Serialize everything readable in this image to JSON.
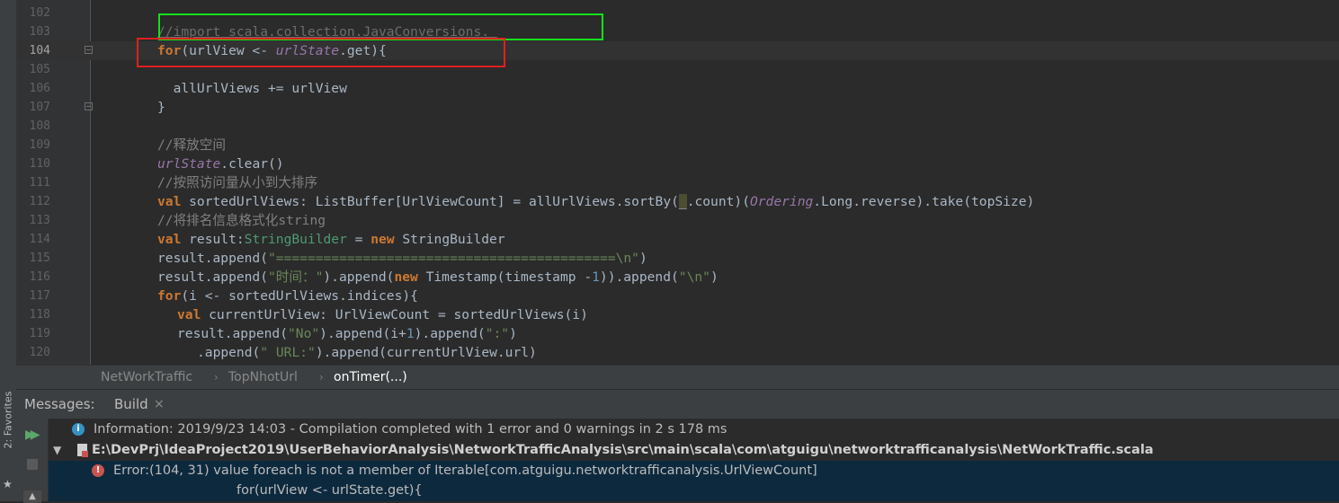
{
  "editor": {
    "lines": [
      {
        "num": "102",
        "text": ""
      },
      {
        "num": "103",
        "text": "//import scala.collection.JavaConversions._"
      },
      {
        "num": "104",
        "kw": "for",
        "a": "(urlView <- ",
        "it": "urlState",
        "b": ".get){"
      },
      {
        "num": "105",
        "text": ""
      },
      {
        "num": "106",
        "text": "  allUrlViews += urlView"
      },
      {
        "num": "107",
        "text": "}"
      },
      {
        "num": "108",
        "text": ""
      },
      {
        "num": "109",
        "text": "//释放空间"
      },
      {
        "num": "110",
        "it": "urlState",
        "b": ".clear()"
      },
      {
        "num": "111",
        "text": "//按照访问量从小到大排序"
      },
      {
        "num": "112",
        "kw": "val",
        "a": " sortedUrlViews: ListBuffer[UrlViewCount] = allUrlViews.sortBy(",
        "hl": "_",
        "b": ".count)(",
        "it": "Ordering",
        "c": ".Long.reverse).take(topSize)"
      },
      {
        "num": "113",
        "text": "//将排名信息格式化string"
      },
      {
        "num": "114",
        "kw": "val",
        "a": " result:",
        "ty": "StringBuilder",
        "b": " = ",
        "kw2": "new",
        "c": " StringBuilder"
      },
      {
        "num": "115",
        "a": "result.append(",
        "str": "\"===========================================\\n\"",
        "b": ")"
      },
      {
        "num": "116",
        "a": "result.append(",
        "str": "\"时间：\"",
        "b": ").append(",
        "kw": "new",
        "c": " Timestamp(timestamp -",
        "num_lit": "1",
        "d": ")).append(",
        "str2": "\"\\n\"",
        "e": ")"
      },
      {
        "num": "117",
        "kw": "for",
        "a": "(i <- sortedUrlViews.indices){"
      },
      {
        "num": "118",
        "kw": "val",
        "a": " currentUrlView: UrlViewCount = sortedUrlViews(i)"
      },
      {
        "num": "119",
        "a": "result.append(",
        "str": "\"No\"",
        "b": ").append(i+",
        "num_lit": "1",
        "c": ").append(",
        "str2": "\":\"",
        "d": ")"
      },
      {
        "num": "120",
        "a": ".append(",
        "str": "\" URL:\"",
        "b": ").append(currentUrlView.url)"
      }
    ]
  },
  "breadcrumb": [
    "NetWorkTraffic",
    "TopNhotUrl",
    "onTimer(...)"
  ],
  "messages_panel": {
    "title": "Messages:",
    "tab": "Build",
    "tab_close": "×",
    "rows": [
      {
        "icon": "info-icon",
        "text": "Information: 2019/9/23 14:03 - Compilation completed with 1 error and 0 warnings in 2 s 178 ms"
      },
      {
        "icon": "file-icon",
        "text": "E:\\DevPrj\\IdeaProject2019\\UserBehaviorAnalysis\\NetworkTrafficAnalysis\\src\\main\\scala\\com\\atguigu\\networktrafficanalysis\\NetWorkTraffic.scala"
      },
      {
        "icon": "error-icon",
        "text": "Error:(104, 31)  value foreach is not a member of Iterable[com.atguigu.networktrafficanalysis.UrlViewCount]"
      },
      {
        "text": "for(urlView <- urlState.get){"
      }
    ]
  },
  "side_stripe": {
    "label": "2: Favorites"
  },
  "colors": {
    "accent_green_box": "#16e01b",
    "accent_red_box": "#e0201e",
    "error": "#c75450",
    "info": "#3592c4"
  }
}
